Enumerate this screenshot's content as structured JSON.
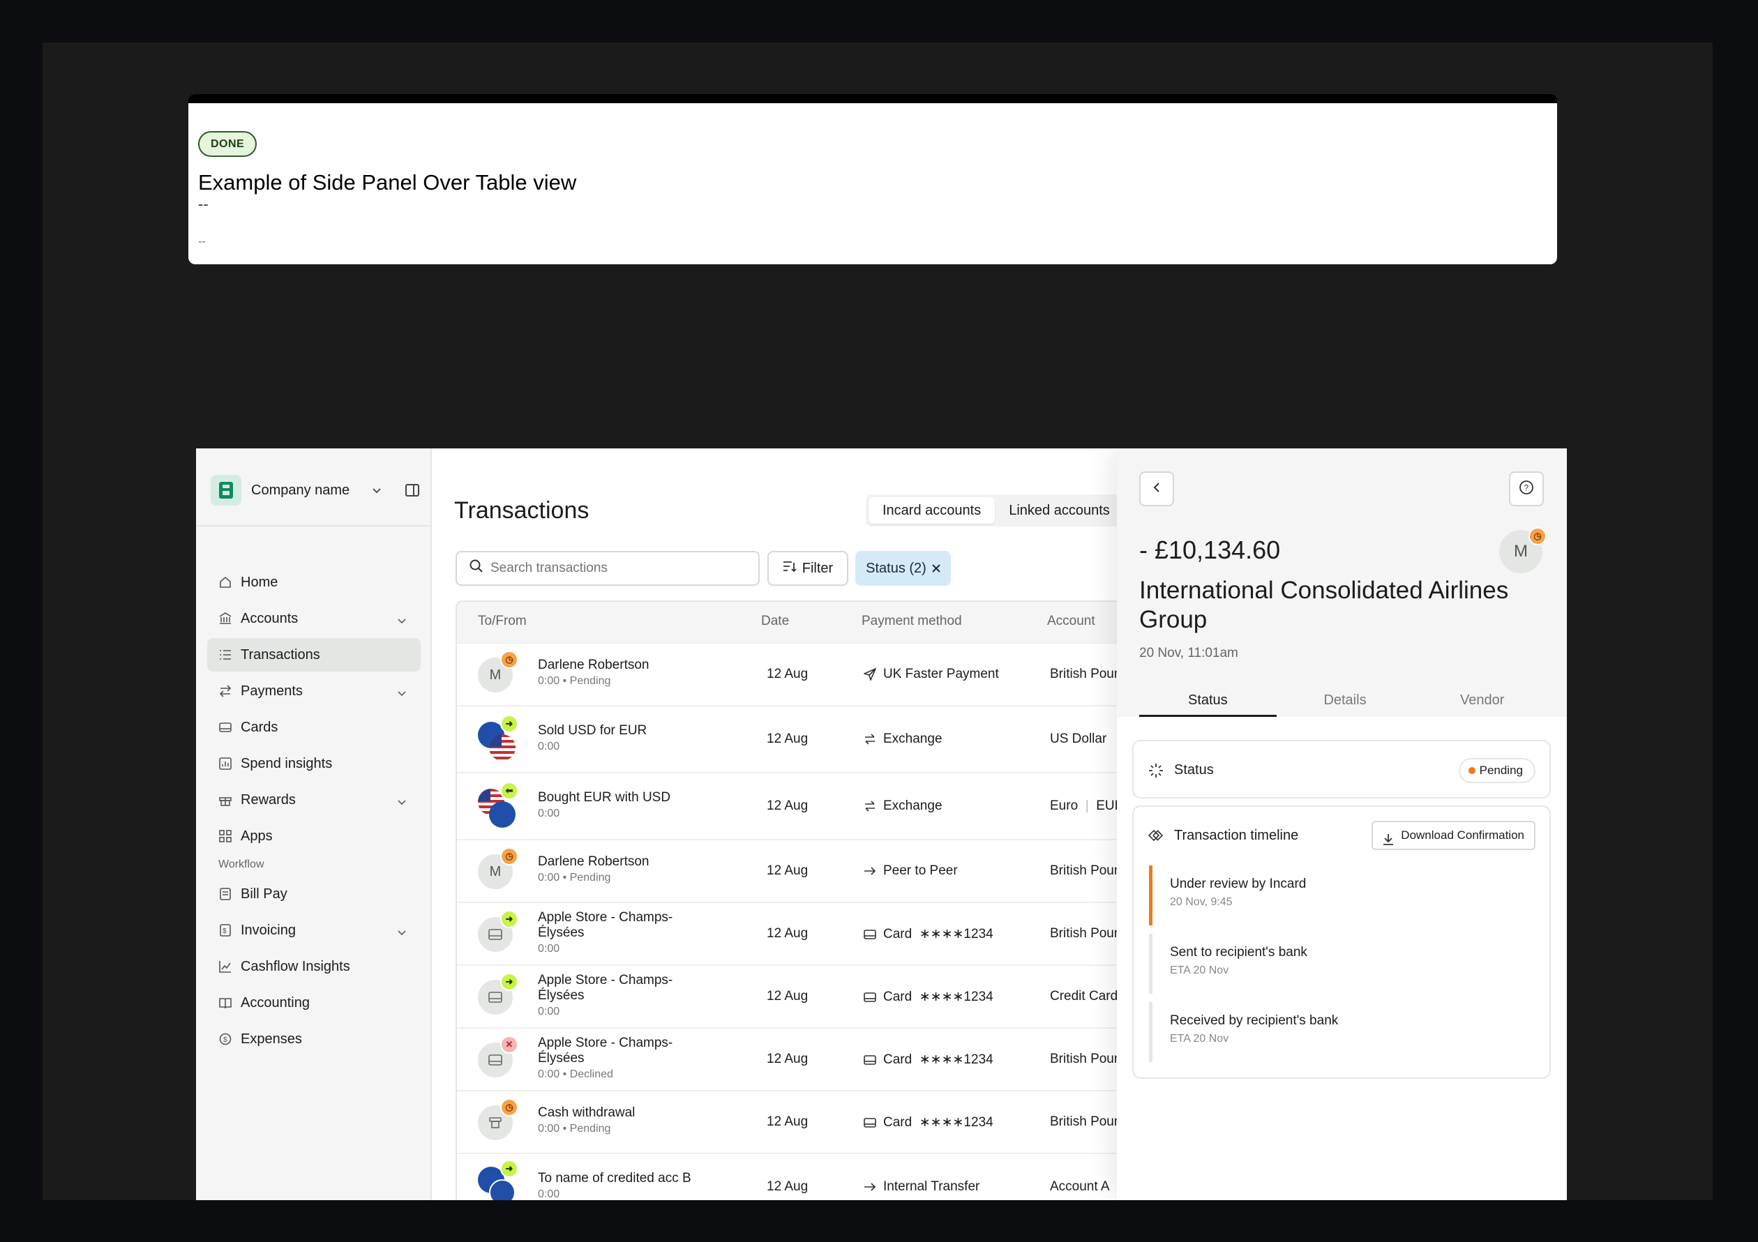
{
  "doc_card": {
    "badge": "DONE",
    "title": "Example of Side Panel Over Table view",
    "dash1": "--",
    "dash2": "--"
  },
  "sidebar": {
    "company_name": "Company name",
    "items": [
      {
        "label": "Home",
        "icon": "home-icon"
      },
      {
        "label": "Accounts",
        "icon": "bank-icon",
        "expandable": true
      },
      {
        "label": "Transactions",
        "icon": "list-icon",
        "active": true
      },
      {
        "label": "Payments",
        "icon": "arrows-icon",
        "expandable": true
      },
      {
        "label": "Cards",
        "icon": "card-icon"
      },
      {
        "label": "Spend insights",
        "icon": "chart-icon"
      },
      {
        "label": "Rewards",
        "icon": "gift-icon",
        "expandable": true
      },
      {
        "label": "Apps",
        "icon": "grid-icon"
      }
    ],
    "section_label": "Workflow",
    "workflow_items": [
      {
        "label": "Bill Pay",
        "icon": "bill-icon"
      },
      {
        "label": "Invoicing",
        "icon": "invoice-icon",
        "expandable": true
      },
      {
        "label": "Cashflow Insights",
        "icon": "trend-icon"
      },
      {
        "label": "Accounting",
        "icon": "book-icon"
      },
      {
        "label": "Expenses",
        "icon": "coin-icon"
      }
    ]
  },
  "main": {
    "title": "Transactions",
    "segments": [
      "Incard accounts",
      "Linked accounts"
    ],
    "search_placeholder": "Search transactions",
    "filter_label": "Filter",
    "status_chip": "Status (2)",
    "columns": [
      "To/From",
      "Date",
      "Payment method",
      "Account"
    ],
    "rows": [
      {
        "name": "Darlene Robertson",
        "sub": "0:00",
        "state": "Pending",
        "date": "12 Aug",
        "method": "UK Faster Payment",
        "method_icon": "send-icon",
        "account": "British Poun",
        "avatar": "M",
        "badge": "orange"
      },
      {
        "name": "Sold USD for EUR",
        "sub": "0:00",
        "state": "",
        "date": "12 Aug",
        "method": "Exchange",
        "method_icon": "exchange-icon",
        "account": "US Dollar",
        "avatar": "eu-us",
        "badge": "green-right"
      },
      {
        "name": "Bought EUR with USD",
        "sub": "0:00",
        "state": "",
        "date": "12 Aug",
        "method": "Exchange",
        "method_icon": "exchange-icon",
        "account": "Euro",
        "account_extra": "EUR",
        "avatar": "us-eu",
        "badge": "green-left"
      },
      {
        "name": "Darlene Robertson",
        "sub": "0:00",
        "state": "Pending",
        "date": "12 Aug",
        "method": "Peer to Peer",
        "method_icon": "arrow-right-icon",
        "account": "British Poun",
        "avatar": "M",
        "badge": "orange"
      },
      {
        "name_l1": "Apple Store - Champs-",
        "name_l2": "Élysées",
        "sub": "0:00",
        "state": "",
        "date": "12 Aug",
        "method": "Card",
        "card_num": "∗∗∗∗1234",
        "method_icon": "card-icon",
        "account": "British Poun",
        "avatar": "card",
        "badge": "green-right"
      },
      {
        "name_l1": "Apple Store - Champs-",
        "name_l2": "Élysées",
        "sub": "0:00",
        "state": "",
        "date": "12 Aug",
        "method": "Card",
        "card_num": "∗∗∗∗1234",
        "method_icon": "card-icon",
        "account": "Credit Card",
        "avatar": "card",
        "badge": "green-right"
      },
      {
        "name_l1": "Apple Store - Champs-",
        "name_l2": "Élysées",
        "sub": "0:00",
        "state": "Declined",
        "date": "12 Aug",
        "method": "Card",
        "card_num": "∗∗∗∗1234",
        "method_icon": "card-icon",
        "account": "British Poun",
        "avatar": "card",
        "badge": "red"
      },
      {
        "name": "Cash withdrawal",
        "sub": "0:00",
        "state": "Pending",
        "date": "12 Aug",
        "method": "Card",
        "card_num": "∗∗∗∗1234",
        "method_icon": "card-icon",
        "account": "British Poun",
        "avatar": "atm",
        "badge": "orange"
      },
      {
        "name": "To name of credited acc B",
        "sub": "0:00",
        "state": "",
        "date": "12 Aug",
        "method": "Internal Transfer",
        "method_icon": "arrow-right-icon",
        "account": "Account A",
        "avatar": "eu-eu",
        "badge": "green-right"
      }
    ]
  },
  "panel": {
    "amount": "- £10,134.60",
    "avatar": "M",
    "merchant": "International Consolidated Airlines Group",
    "date": "20 Nov, 11:01am",
    "tabs": [
      "Status",
      "Details",
      "Vendor"
    ],
    "status_label": "Status",
    "status_value": "Pending",
    "timeline_title": "Transaction timeline",
    "download_label": "Download Confirmation",
    "timeline": [
      {
        "title": "Under review by Incard",
        "sub": "20 Nov, 9:45",
        "current": true
      },
      {
        "title": "Sent to recipient's bank",
        "sub": "ETA 20 Nov"
      },
      {
        "title": "Received by recipient's bank",
        "sub": "ETA 20 Nov"
      }
    ]
  },
  "colors": {
    "accent_pending": "#f07a1a",
    "badge_green": "#c8f24a",
    "chip_blue": "#d4ebf7"
  }
}
